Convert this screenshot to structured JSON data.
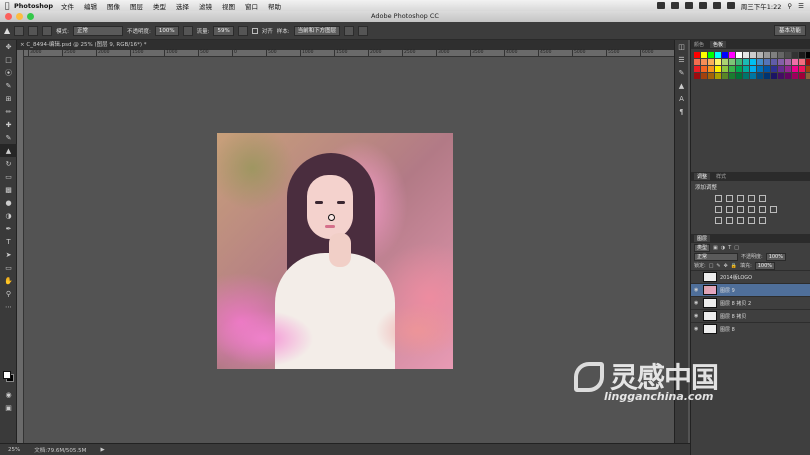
{
  "macbar": {
    "app": "Photoshop",
    "menus": [
      "文件",
      "编辑",
      "图像",
      "图层",
      "类型",
      "选择",
      "滤镜",
      "视图",
      "窗口",
      "帮助"
    ],
    "clock": "周三下午1:22"
  },
  "window": {
    "title": "Adobe Photoshop CC"
  },
  "options": {
    "mode_label": "模式:",
    "mode_value": "正常",
    "opacity_label": "不透明度:",
    "opacity_value": "100%",
    "flow_label": "流量:",
    "flow_value": "59%",
    "aligned_label": "对齐",
    "sample_label": "样本:",
    "sample_value": "当前和下方图层",
    "workspace": "基本功能"
  },
  "document": {
    "tab_title": "C_8494-编辑.psd @ 25% (图层 9, RGB/16*) *"
  },
  "ruler": {
    "ticks": [
      "3000",
      "2500",
      "2000",
      "1500",
      "1000",
      "500",
      "0",
      "500",
      "1000",
      "1500",
      "2000",
      "2500",
      "3000",
      "3500",
      "4000",
      "4500",
      "5000",
      "5500",
      "6000",
      "6500"
    ]
  },
  "status": {
    "zoom": "25%",
    "doc": "文档:79.6M/505.5M"
  },
  "panels": {
    "color_tabs": [
      "颜色",
      "色板"
    ],
    "adjust_tabs": [
      "调整",
      "样式"
    ],
    "adjust_title": "添加调整",
    "layers_tab": "图层",
    "kind_label": "类型",
    "blend_value": "正常",
    "opacity_label": "不透明度:",
    "opacity_value": "100%",
    "lock_label": "锁定:",
    "fill_label": "填充:",
    "fill_value": "100%",
    "layers": [
      {
        "name": "2014版LOGO",
        "selected": false
      },
      {
        "name": "图层 9",
        "selected": true
      },
      {
        "name": "图层 8 拷贝 2",
        "selected": false
      },
      {
        "name": "图层 8 拷贝",
        "selected": false
      },
      {
        "name": "图层 8",
        "selected": false
      }
    ]
  },
  "watermark": {
    "brand": "灵感中国",
    "url": "lingganchina.com"
  },
  "colors": {
    "swatches": [
      "#ff0000",
      "#ffff00",
      "#00ff00",
      "#00ffff",
      "#0000ff",
      "#ff00ff",
      "#ffffff",
      "#e6e6e6",
      "#cccccc",
      "#b3b3b3",
      "#999999",
      "#808080",
      "#666666",
      "#4d4d4d",
      "#333333",
      "#1a1a1a",
      "#000000",
      "#f26c4f",
      "#f68e56",
      "#fbaf5c",
      "#fff467",
      "#acd372",
      "#7cc576",
      "#3bb878",
      "#1abbb4",
      "#00bff3",
      "#438ccb",
      "#5574b9",
      "#605ca8",
      "#855fa8",
      "#a763a9",
      "#ef6ea8",
      "#f16d7e",
      "#9e0b0f",
      "#ed1c24",
      "#f26522",
      "#f7941d",
      "#fff200",
      "#8dc63f",
      "#39b54a",
      "#00a651",
      "#00a99d",
      "#00aeef",
      "#0072bc",
      "#0054a6",
      "#2e3192",
      "#662d91",
      "#92278f",
      "#ec008c",
      "#ed145b",
      "#a0410d",
      "#9e0b0f",
      "#a0410d",
      "#a36209",
      "#aba000",
      "#598527",
      "#1a7b30",
      "#007236",
      "#00746b",
      "#0076a3",
      "#004b80",
      "#003471",
      "#1b1464",
      "#440e62",
      "#630460",
      "#9e005d",
      "#9e0039",
      "#8c6239"
    ]
  }
}
